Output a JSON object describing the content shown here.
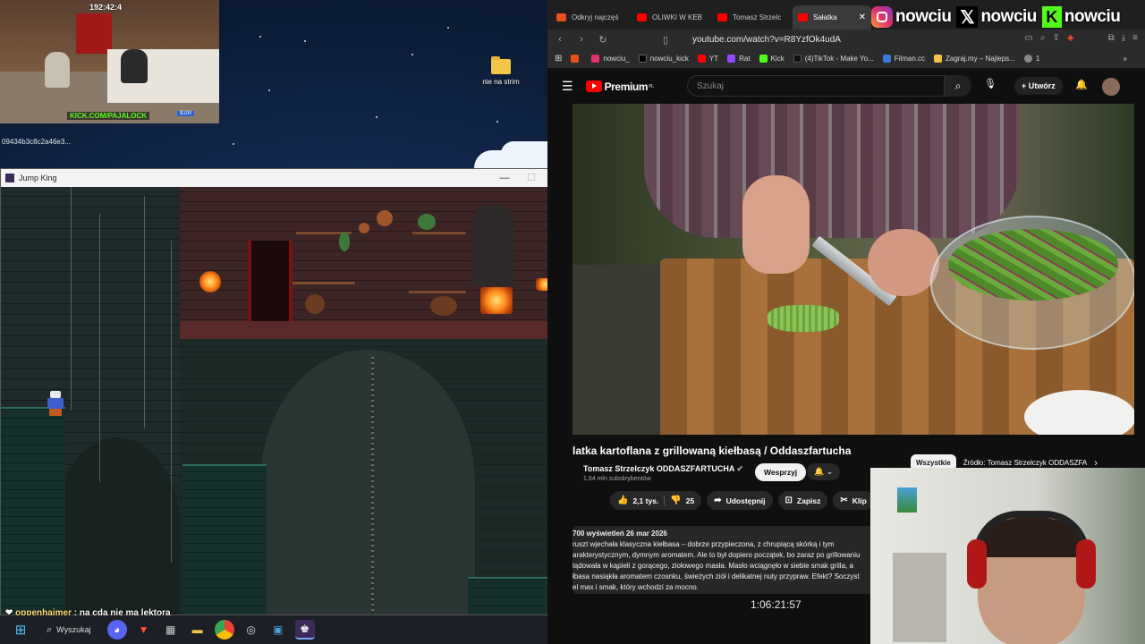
{
  "desktop": {
    "folder_label": "nie na strim",
    "hash_label": "09434b3c8c2a46e3..."
  },
  "stream_overlay": {
    "clock": "192:42:4",
    "kick_text": "KICK.COM/PAJALOCK",
    "amount": "$100"
  },
  "game_window": {
    "title": "Jump King",
    "minimize": "—",
    "maximize": "☐",
    "close": "✕"
  },
  "chat": {
    "user": "oppenhajmer",
    "message": ": na cda nie ma lektora"
  },
  "taskbar": {
    "search_label": "Wyszukaj",
    "apps": [
      "windows-start",
      "search",
      "discord",
      "brave",
      "task-manager",
      "file-explorer",
      "chrome",
      "obs",
      "photos",
      "jump-king"
    ]
  },
  "browser": {
    "tabs": [
      {
        "label": "Odkryj najczęś",
        "color": "#e8501a",
        "active": false
      },
      {
        "label": "OLIWKI W KEB",
        "color": "#ff0000",
        "active": false
      },
      {
        "label": "Tomasz Strzelc",
        "color": "#ff0000",
        "active": false
      },
      {
        "label": "Sałatka",
        "color": "#ff0000",
        "active": true
      }
    ],
    "socials": [
      "nowciu",
      "nowciu",
      "nowciu"
    ],
    "url": "youtube.com/watch?v=R8YzfOk4udA",
    "bookmarks": [
      {
        "label": "",
        "color": "#e8501a"
      },
      {
        "label": "nowciu_",
        "color": "#e1306c"
      },
      {
        "label": "nowciu_kick",
        "color": "#000000"
      },
      {
        "label": "YT",
        "color": "#ff0000"
      },
      {
        "label": "Rat",
        "color": "#9146ff"
      },
      {
        "label": "Kick",
        "color": "#53fc18"
      },
      {
        "label": "(4)TikTok - Make Yo...",
        "color": "#111111"
      },
      {
        "label": "Filman.cc",
        "color": "#3a7bd5"
      },
      {
        "label": "Zagraj.my – Najleps...",
        "color": "#f2c14e"
      },
      {
        "label": "1",
        "color": "#888888"
      }
    ]
  },
  "youtube": {
    "brand": "Premium",
    "brand_sup": "PL",
    "search_placeholder": "Szukaj",
    "create_label": "Utwórz",
    "video_title": "latka kartoflana z grillowaną kiełbasą / Oddaszfartucha",
    "channel_name": "Tomasz Strzelczyk ODDASZFARTUCHA",
    "subscribers": "1,64 mln subskrybentów",
    "support_label": "Wesprzyj",
    "bell_label": "🔔 ⌄",
    "chips": [
      "Wszystkie",
      "Źródło: Tomasz Strzelczyk ODDASZFA"
    ],
    "likes": "2,1 tys.",
    "dislikes": "25",
    "share_label": "Udostępnij",
    "save_label": "Zapisz",
    "clip_label": "Klip",
    "description_header": "700 wyświetleń  26 mar 2026",
    "description_lines": [
      "ruszt wjechała klasyczna kiełbasa – dobrze przypieczona, z chrupiącą skórką i tym",
      "arakterystycznym, dymnym aromatem. Ale to był dopiero początek, bo zaraz po grillowaniu",
      "lądowała w kąpieli z gorącego, ziołowego masła. Masło wciągnęło w siebie smak grilla, a",
      "łbasa nasiąkła aromatem czosnku, świeżych ziół i delikatnej nuty przypraw. Efekt? Soczyst",
      "el max i smak, który wchodzi za mocno."
    ],
    "timer": "1:06:21:57"
  }
}
